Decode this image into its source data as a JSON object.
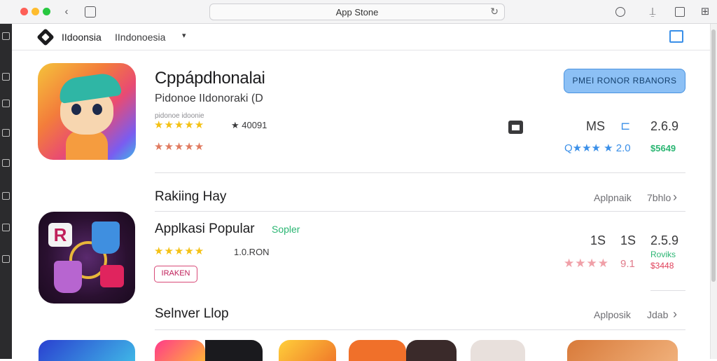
{
  "browser": {
    "url_text": "App Stone",
    "back_icon": "chevron-left-icon",
    "reload_icon": "reload-icon"
  },
  "store_header": {
    "region_label": "IIdoonsia",
    "region_value": "IIndonoesia",
    "caret": "▾"
  },
  "featured": {
    "title": "Cppápdhonalai",
    "subtitle": "Pidonoe IIdonoraki (D",
    "tiny_label": "pidonoe idoonie",
    "stars": "★★★★★",
    "rating_meta": "★ 40091",
    "stars_secondary": "★★★★★",
    "get_button": "PMEI RONOR RBANORS",
    "stat_ms": "MS",
    "stat_version": "2.6.9",
    "stat_rating": "Q★★★ ★ 2.0",
    "stat_price": "$5649"
  },
  "sections": [
    {
      "title": "Rakiing Hay",
      "link_a": "Aplpnaik",
      "link_b": "7bhlo",
      "chevron": "›"
    },
    {
      "title": "Selnver Llop",
      "link_a": "Aplposik",
      "link_b": "Jdab",
      "chevron": "›"
    }
  ],
  "popular": {
    "title": "Applkasi Popular",
    "badge": "Sopler",
    "stars": "★★★★★",
    "rating_meta": "1.0.RON",
    "tag": "IRAKEN",
    "stat_a": "1S",
    "stat_b": "1S",
    "stat_version": "2.5.9",
    "stat_green": "Roviks",
    "stat_pink_value": "9.1",
    "stat_price": "$3448"
  },
  "colors": {
    "accent_blue": "#3a8fe8",
    "green": "#2bb673",
    "star_yellow": "#f4c114"
  }
}
